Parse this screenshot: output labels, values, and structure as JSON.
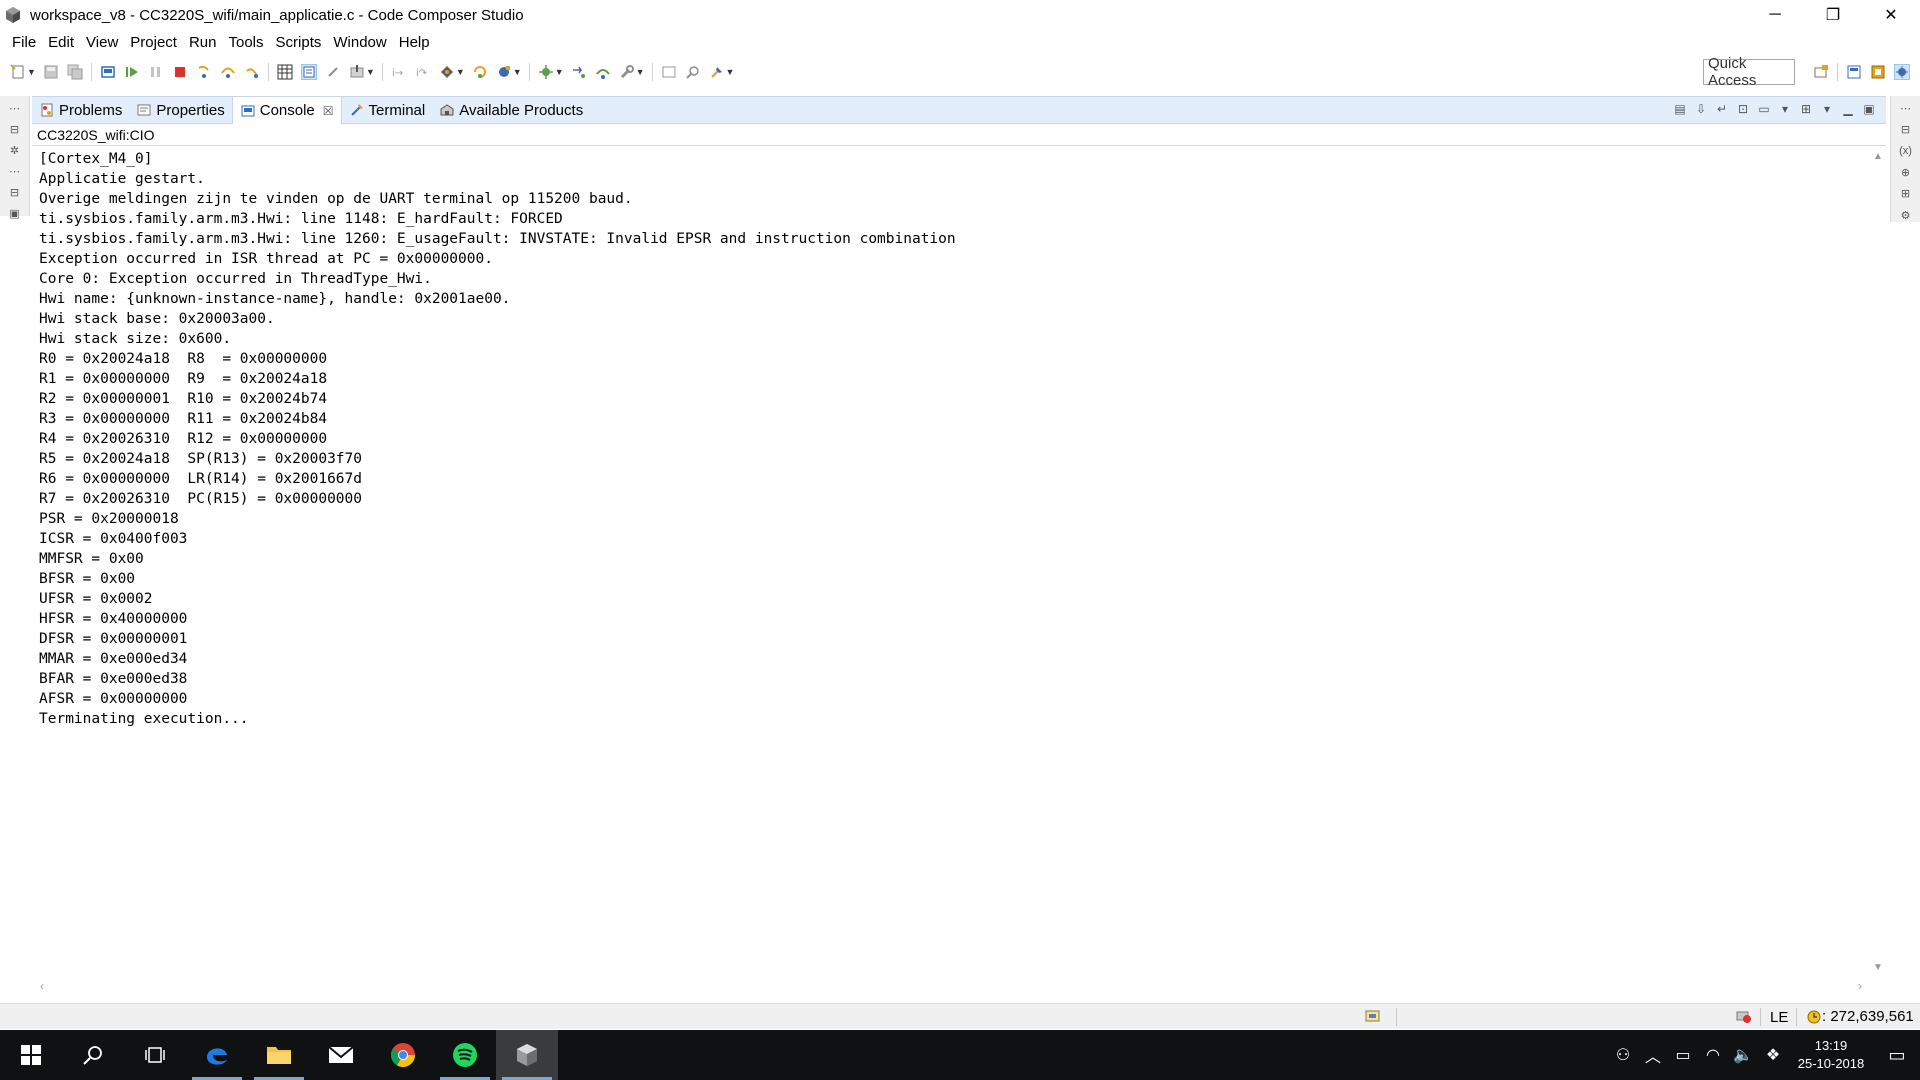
{
  "window": {
    "title": "workspace_v8 - CC3220S_wifi/main_applicatie.c - Code Composer Studio",
    "minimize": "─",
    "maximize": "❐",
    "close": "✕"
  },
  "menu": [
    "File",
    "Edit",
    "View",
    "Project",
    "Run",
    "Tools",
    "Scripts",
    "Window",
    "Help"
  ],
  "toolbar": {
    "quick_access": "Quick Access"
  },
  "tabs": [
    {
      "label": "Problems",
      "icon": "problems-icon",
      "active": false
    },
    {
      "label": "Properties",
      "icon": "properties-icon",
      "active": false
    },
    {
      "label": "Console",
      "icon": "console-icon",
      "active": true
    },
    {
      "label": "Terminal",
      "icon": "terminal-icon",
      "active": false
    },
    {
      "label": "Available Products",
      "icon": "products-icon",
      "active": false
    }
  ],
  "console": {
    "name": "CC3220S_wifi:CIO",
    "lines": [
      "[Cortex_M4_0]",
      "Applicatie gestart.",
      "Overige meldingen zijn te vinden op de UART terminal op 115200 baud.",
      "ti.sysbios.family.arm.m3.Hwi: line 1148: E_hardFault: FORCED",
      "ti.sysbios.family.arm.m3.Hwi: line 1260: E_usageFault: INVSTATE: Invalid EPSR and instruction combination",
      "Exception occurred in ISR thread at PC = 0x00000000.",
      "Core 0: Exception occurred in ThreadType_Hwi.",
      "Hwi name: {unknown-instance-name}, handle: 0x2001ae00.",
      "Hwi stack base: 0x20003a00.",
      "Hwi stack size: 0x600.",
      "R0 = 0x20024a18  R8  = 0x00000000",
      "R1 = 0x00000000  R9  = 0x20024a18",
      "R2 = 0x00000001  R10 = 0x20024b74",
      "R3 = 0x00000000  R11 = 0x20024b84",
      "R4 = 0x20026310  R12 = 0x00000000",
      "R5 = 0x20024a18  SP(R13) = 0x20003f70",
      "R6 = 0x00000000  LR(R14) = 0x2001667d",
      "R7 = 0x20026310  PC(R15) = 0x00000000",
      "PSR = 0x20000018",
      "ICSR = 0x0400f003",
      "MMFSR = 0x00",
      "BFSR = 0x00",
      "UFSR = 0x0002",
      "HFSR = 0x40000000",
      "DFSR = 0x00000001",
      "MMAR = 0xe000ed34",
      "BFAR = 0xe000ed38",
      "AFSR = 0x00000000",
      "Terminating execution..."
    ]
  },
  "status": {
    "endian": "LE",
    "memory": ": 272,639,561"
  },
  "taskbar": {
    "time": "13:19",
    "date": "25-10-2018"
  }
}
